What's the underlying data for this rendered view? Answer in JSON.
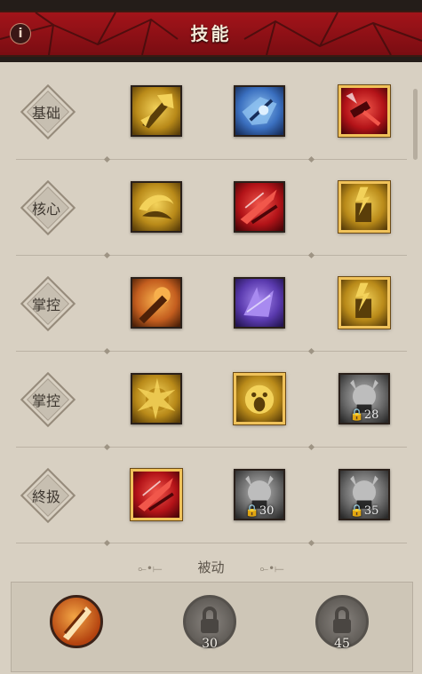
{
  "header": {
    "title": "技能",
    "info_icon": "i"
  },
  "tiers": [
    {
      "label": "基础",
      "skills": [
        {
          "icon": "gold-axe-strike-icon",
          "selected": false,
          "lock_level": ""
        },
        {
          "icon": "blue-ice-blade-icon",
          "selected": false,
          "lock_level": ""
        },
        {
          "icon": "red-hammer-strike-icon",
          "selected": true,
          "lock_level": ""
        }
      ]
    },
    {
      "label": "核心",
      "skills": [
        {
          "icon": "gold-whirlwind-icon",
          "selected": false,
          "lock_level": ""
        },
        {
          "icon": "red-blade-slash-icon",
          "selected": false,
          "lock_level": ""
        },
        {
          "icon": "gold-lightning-hammer-icon",
          "selected": true,
          "lock_level": ""
        }
      ]
    },
    {
      "label": "掌控",
      "skills": [
        {
          "icon": "orange-leap-slam-icon",
          "selected": false,
          "lock_level": ""
        },
        {
          "icon": "purple-shockwave-icon",
          "selected": false,
          "lock_level": ""
        },
        {
          "icon": "gold-ground-stomp-icon",
          "selected": true,
          "lock_level": ""
        }
      ]
    },
    {
      "label": "掌控",
      "skills": [
        {
          "icon": "gold-burst-fist-icon",
          "selected": false,
          "lock_level": ""
        },
        {
          "icon": "gold-war-cry-icon",
          "selected": true,
          "lock_level": ""
        },
        {
          "icon": "gray-locked-skill-icon",
          "selected": false,
          "lock_level": "28"
        }
      ]
    },
    {
      "label": "終扱",
      "skills": [
        {
          "icon": "red-fury-slash-icon",
          "selected": true,
          "lock_level": ""
        },
        {
          "icon": "gray-locked-demon-icon",
          "selected": false,
          "lock_level": "30"
        },
        {
          "icon": "gray-locked-berserker-icon",
          "selected": false,
          "lock_level": "35"
        }
      ]
    }
  ],
  "passive": {
    "title": "被动",
    "slots": [
      {
        "icon": "orange-blade-passive-icon",
        "unlocked": true,
        "level": ""
      },
      {
        "icon": "padlock-icon",
        "unlocked": false,
        "level": "30"
      },
      {
        "icon": "padlock-icon",
        "unlocked": false,
        "level": "45"
      }
    ]
  },
  "colors": {
    "header_red": "#a3141a",
    "panel_bg": "#d8d0c2",
    "selected_border": "#f0c25a",
    "gold_skill": "#e2b12c",
    "blue_skill": "#3f76c6",
    "red_skill": "#c21d22",
    "purple_skill": "#5b3cae",
    "orange_skill": "#d3702a",
    "locked_skill": "#5a5a5a"
  }
}
